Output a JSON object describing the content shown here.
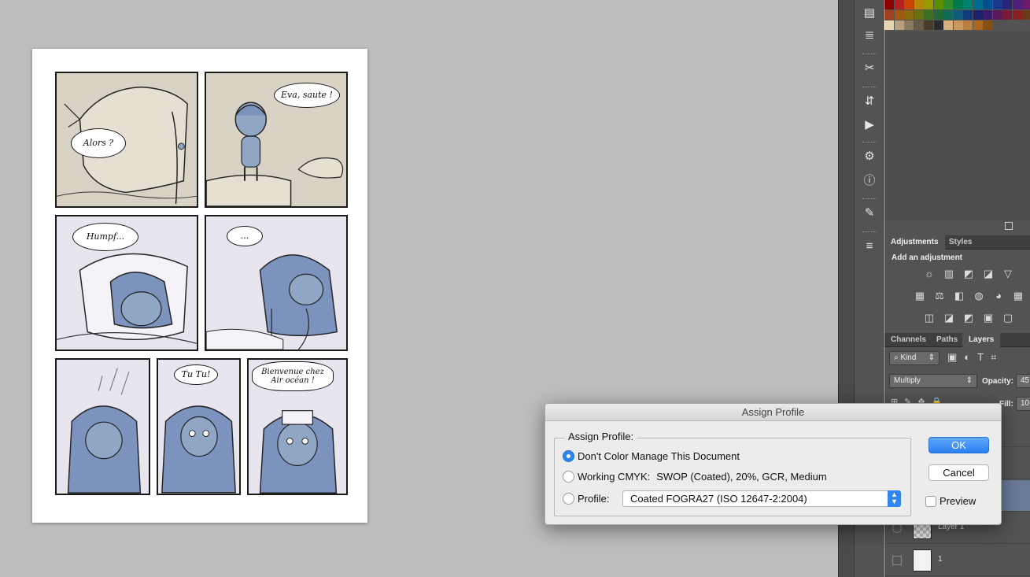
{
  "comic": {
    "bubbles": {
      "alors": "Alors ?",
      "eva": "Eva, saute !",
      "humpf": "Humpf...",
      "dots": "...",
      "tutu": "Tu Tu!",
      "bienvenue": "Bienvenue chez Air océan !"
    }
  },
  "layers_panel": {
    "adjustments_tabs": [
      "Adjustments",
      "Styles"
    ],
    "add_adjustment": "Add an adjustment",
    "tabs": [
      "Channels",
      "Paths",
      "Layers"
    ],
    "kind_label": "Kind",
    "blend_mode": "Multiply",
    "opacity_label": "Opacity:",
    "opacity_value": "45",
    "fill_label": "Fill:",
    "fill_value": "10",
    "layers": [
      "Layer 1",
      "1"
    ]
  },
  "dialog": {
    "title": "Assign Profile",
    "group_label": "Assign Profile:",
    "option_dont_manage": "Don't Color Manage This Document",
    "option_working_label": "Working CMYK:",
    "option_working_value": "SWOP (Coated), 20%, GCR, Medium",
    "option_profile_label": "Profile:",
    "profile_selected": "Coated FOGRA27 (ISO 12647-2:2004)",
    "ok_label": "OK",
    "cancel_label": "Cancel",
    "preview_label": "Preview"
  },
  "colors": {
    "accent": "#2f86f0",
    "canvas_bg": "#bdbdbd",
    "panel_bg": "#535353"
  }
}
